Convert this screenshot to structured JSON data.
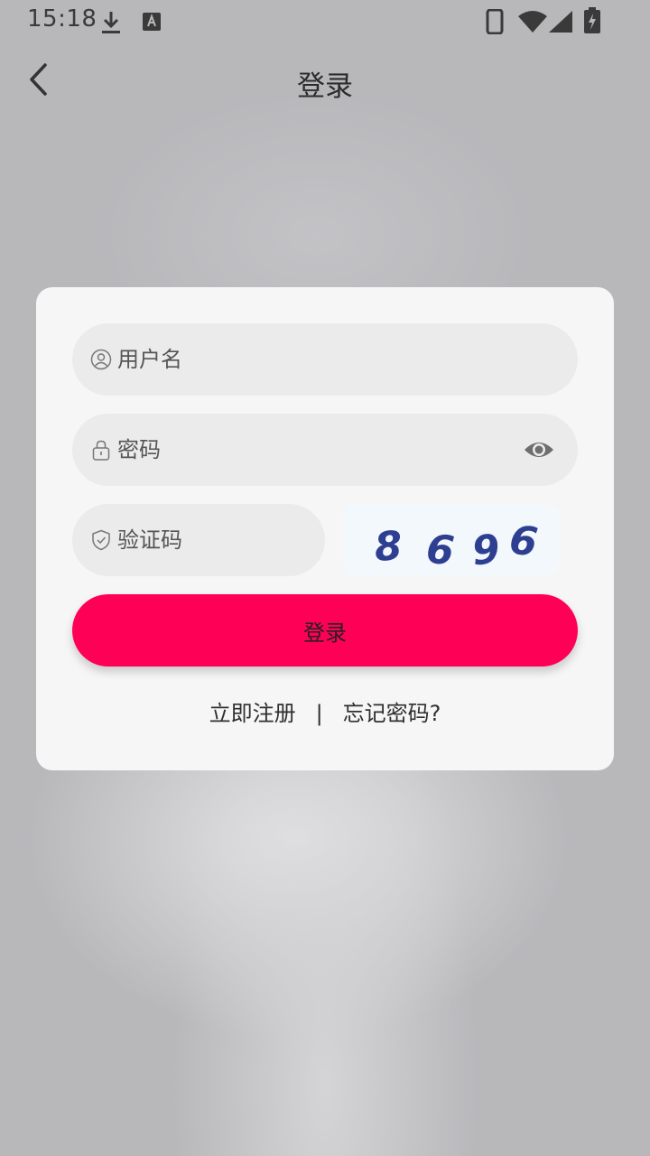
{
  "status_bar": {
    "time": "15:18",
    "icons": [
      "download-icon",
      "a11y-keyboard-icon",
      "phone-icon",
      "wifi-icon",
      "signal-icon",
      "battery-charging-icon"
    ]
  },
  "header": {
    "title": "登录",
    "back_icon": "chevron-left-icon"
  },
  "form": {
    "username": {
      "placeholder": "用户名",
      "value": "",
      "icon": "user-icon"
    },
    "password": {
      "placeholder": "密码",
      "value": "",
      "icon": "lock-icon",
      "toggle_icon": "eye-icon"
    },
    "captcha": {
      "placeholder": "验证码",
      "value": "",
      "icon": "shield-icon",
      "code": "8696"
    },
    "login_label": "登录"
  },
  "links": {
    "register": "立即注册",
    "separator": "|",
    "forgot": "忘记密码?"
  },
  "colors": {
    "primary": "#ff0057",
    "captcha_text": "#2e3f91"
  }
}
